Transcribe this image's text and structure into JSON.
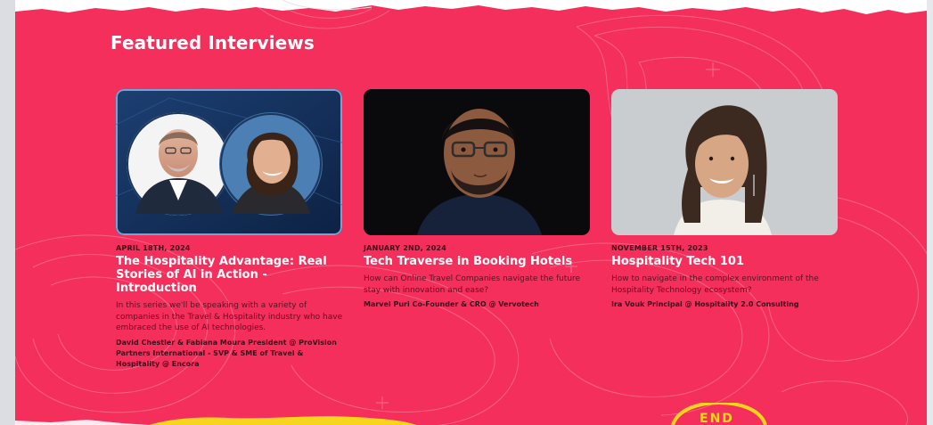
{
  "section": {
    "title": "Featured Interviews",
    "background_color": "#f42f5c",
    "footer_stamp_text": "END"
  },
  "interviews": [
    {
      "date": "APRIL 18TH, 2024",
      "title": "The Hospitality Advantage: Real Stories of AI in Action - Introduction",
      "description": "In this series we'll be speaking with a variety of companies in the Travel & Hospitality industry who have embraced the use of AI technologies.",
      "people": "David Chestler & Fabiana Moura President @ ProVision Partners International - SVP & SME of Travel & Hospitality @ Encora",
      "thumbnail": "two-guest-portrait"
    },
    {
      "date": "JANUARY 2ND, 2024",
      "title": "Tech Traverse in Booking Hotels",
      "description": "How can Online Travel Companies navigate the future stay with innovation and ease?",
      "people": "Marvel Puri Co-Founder & CRO @ Vervotech",
      "thumbnail": "guest-portrait-dark"
    },
    {
      "date": "NOVEMBER 15TH, 2023",
      "title": "Hospitality Tech 101",
      "description": "How to navigate in the complex environment of the Hospitality Technology ecosystem?",
      "people": "Ira Vouk Principal @ Hospitality 2.0 Consulting",
      "thumbnail": "guest-portrait-light"
    }
  ]
}
